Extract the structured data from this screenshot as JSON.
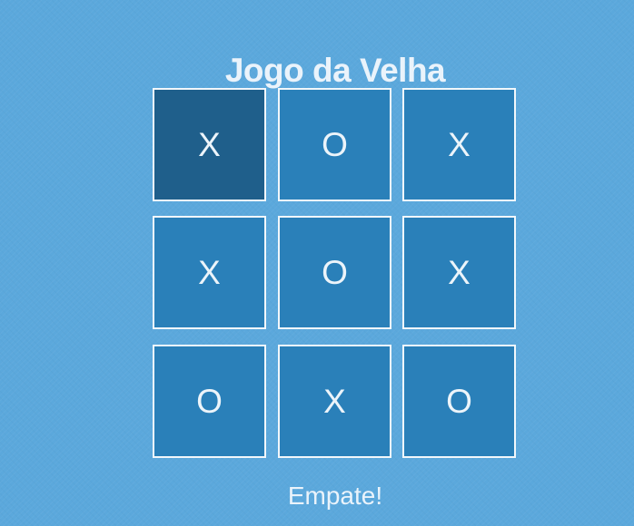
{
  "title": "Jogo da Velha",
  "board": {
    "rows": [
      [
        "X",
        "O",
        "X"
      ],
      [
        "X",
        "O",
        "X"
      ],
      [
        "O",
        "X",
        "O"
      ]
    ],
    "highlighted_cell": "row 1, column 1"
  },
  "status": "Empate!",
  "colors": {
    "background": "#5ba8dc",
    "cell": "#2a80b9",
    "cell_highlight": "#1f5f8b",
    "cell_border": "#f2f7fb",
    "text": "#eaf3fb"
  }
}
